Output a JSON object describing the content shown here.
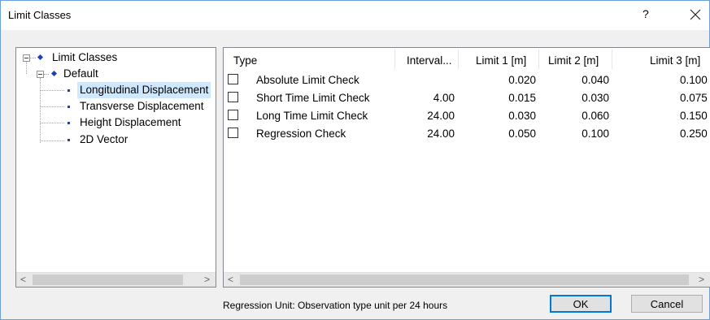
{
  "window": {
    "title": "Limit Classes",
    "help_label": "?",
    "close_icon": "close-icon"
  },
  "tree": {
    "root_label": "Limit Classes",
    "group_label": "Default",
    "items": [
      {
        "label": "Longitudinal Displacement",
        "selected": true
      },
      {
        "label": "Transverse Displacement",
        "selected": false
      },
      {
        "label": "Height Displacement",
        "selected": false
      },
      {
        "label": "2D Vector",
        "selected": false
      }
    ],
    "scroll_left": "<",
    "scroll_right": ">"
  },
  "table": {
    "columns": [
      "Type",
      "Interval...",
      "Limit 1 [m]",
      "Limit 2 [m]",
      "Limit 3 [m]"
    ],
    "rows": [
      {
        "checked": false,
        "type": "Absolute Limit Check",
        "interval": "",
        "limit1": "0.020",
        "limit2": "0.040",
        "limit3": "0.100"
      },
      {
        "checked": false,
        "type": "Short Time Limit Check",
        "interval": "4.00",
        "limit1": "0.015",
        "limit2": "0.030",
        "limit3": "0.075"
      },
      {
        "checked": false,
        "type": "Long Time Limit Check",
        "interval": "24.00",
        "limit1": "0.030",
        "limit2": "0.060",
        "limit3": "0.150"
      },
      {
        "checked": false,
        "type": "Regression Check",
        "interval": "24.00",
        "limit1": "0.050",
        "limit2": "0.100",
        "limit3": "0.250"
      }
    ],
    "scroll_left": "<",
    "scroll_right": ">"
  },
  "footer": {
    "status_text": "Regression Unit: Observation type unit per 24 hours",
    "ok_label": "OK",
    "cancel_label": "Cancel"
  },
  "colors": {
    "selection": "#cde8ff",
    "tree_bullet": "#1f3fb8",
    "default_button_border": "#0078d7"
  }
}
